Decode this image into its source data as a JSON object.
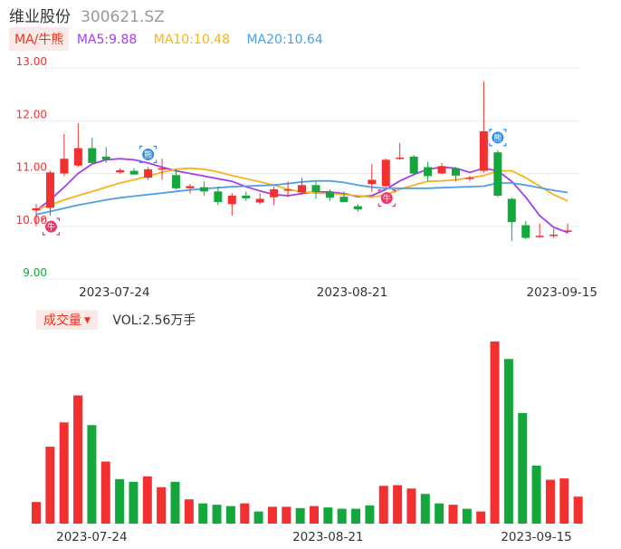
{
  "header": {
    "name": "维业股份",
    "code": "300621.SZ"
  },
  "ma_legend": {
    "toggle": "MA/牛熊",
    "items": [
      {
        "label": "MA5:9.88",
        "color": "#a23ef0"
      },
      {
        "label": "MA10:10.48",
        "color": "#f5b41e"
      },
      {
        "label": "MA20:10.64",
        "color": "#4c9fe8"
      }
    ]
  },
  "volume_legend": {
    "toggle": "成交量",
    "value": "VOL:2.56万手"
  },
  "colors": {
    "up": "#f23030",
    "down": "#14a83c",
    "grid": "#ececec"
  },
  "chart_data": [
    {
      "type": "candlestick",
      "ylim": [
        9.0,
        13.0
      ],
      "y_ticks": [
        "13.00",
        "12.00",
        "11.00",
        "10.00",
        "9.00"
      ],
      "x_tick_labels": [
        {
          "index": 3,
          "label": "2023-07-24"
        },
        {
          "index": 20,
          "label": "2023-08-21"
        },
        {
          "index": 35,
          "label": "2023-09-15"
        }
      ],
      "series": [
        {
          "name": "K",
          "values": [
            {
              "o": 10.3,
              "h": 10.42,
              "l": 10.0,
              "c": 10.34
            },
            {
              "o": 10.35,
              "h": 11.05,
              "l": 10.2,
              "c": 11.02
            },
            {
              "o": 11.0,
              "h": 11.75,
              "l": 10.95,
              "c": 11.28
            },
            {
              "o": 11.15,
              "h": 11.95,
              "l": 11.12,
              "c": 11.48
            },
            {
              "o": 11.48,
              "h": 11.68,
              "l": 11.18,
              "c": 11.2
            },
            {
              "o": 11.32,
              "h": 11.5,
              "l": 11.2,
              "c": 11.26
            },
            {
              "o": 11.02,
              "h": 11.1,
              "l": 11.0,
              "c": 11.06
            },
            {
              "o": 11.05,
              "h": 11.1,
              "l": 10.98,
              "c": 10.98
            },
            {
              "o": 10.92,
              "h": 11.12,
              "l": 10.88,
              "c": 11.08
            },
            {
              "o": 11.08,
              "h": 11.28,
              "l": 10.88,
              "c": 11.1
            },
            {
              "o": 10.97,
              "h": 11.08,
              "l": 10.7,
              "c": 10.72
            },
            {
              "o": 10.72,
              "h": 10.8,
              "l": 10.62,
              "c": 10.76
            },
            {
              "o": 10.74,
              "h": 10.85,
              "l": 10.58,
              "c": 10.66
            },
            {
              "o": 10.66,
              "h": 10.75,
              "l": 10.4,
              "c": 10.46
            },
            {
              "o": 10.42,
              "h": 10.63,
              "l": 10.2,
              "c": 10.58
            },
            {
              "o": 10.58,
              "h": 10.66,
              "l": 10.48,
              "c": 10.53
            },
            {
              "o": 10.45,
              "h": 10.62,
              "l": 10.42,
              "c": 10.52
            },
            {
              "o": 10.55,
              "h": 10.75,
              "l": 10.4,
              "c": 10.7
            },
            {
              "o": 10.7,
              "h": 10.85,
              "l": 10.55,
              "c": 10.7
            },
            {
              "o": 10.64,
              "h": 10.92,
              "l": 10.6,
              "c": 10.78
            },
            {
              "o": 10.78,
              "h": 10.85,
              "l": 10.52,
              "c": 10.66
            },
            {
              "o": 10.64,
              "h": 10.7,
              "l": 10.48,
              "c": 10.54
            },
            {
              "o": 10.56,
              "h": 10.66,
              "l": 10.45,
              "c": 10.46
            },
            {
              "o": 10.38,
              "h": 10.42,
              "l": 10.28,
              "c": 10.32
            },
            {
              "o": 10.8,
              "h": 11.18,
              "l": 10.65,
              "c": 10.88
            },
            {
              "o": 10.76,
              "h": 11.28,
              "l": 10.74,
              "c": 11.26
            },
            {
              "o": 11.28,
              "h": 11.58,
              "l": 11.26,
              "c": 11.3
            },
            {
              "o": 11.32,
              "h": 11.35,
              "l": 10.98,
              "c": 11.0
            },
            {
              "o": 11.12,
              "h": 11.22,
              "l": 10.85,
              "c": 10.95
            },
            {
              "o": 11.0,
              "h": 11.2,
              "l": 10.98,
              "c": 11.14
            },
            {
              "o": 11.1,
              "h": 11.12,
              "l": 10.85,
              "c": 10.96
            },
            {
              "o": 10.9,
              "h": 10.95,
              "l": 10.86,
              "c": 10.92
            },
            {
              "o": 11.05,
              "h": 12.75,
              "l": 11.02,
              "c": 11.8
            },
            {
              "o": 11.4,
              "h": 11.44,
              "l": 10.55,
              "c": 10.58
            },
            {
              "o": 10.52,
              "h": 10.54,
              "l": 9.72,
              "c": 10.08
            },
            {
              "o": 10.02,
              "h": 10.1,
              "l": 9.75,
              "c": 9.78
            },
            {
              "o": 9.8,
              "h": 10.05,
              "l": 9.78,
              "c": 9.82
            },
            {
              "o": 9.82,
              "h": 9.95,
              "l": 9.78,
              "c": 9.84
            },
            {
              "o": 9.9,
              "h": 10.05,
              "l": 9.86,
              "c": 9.92
            }
          ]
        },
        {
          "name": "MA5",
          "values": [
            10.3,
            10.5,
            10.74,
            11.0,
            11.18,
            11.26,
            11.28,
            11.26,
            11.2,
            11.12,
            11.05,
            11.0,
            10.95,
            10.9,
            10.85,
            10.75,
            10.67,
            10.6,
            10.58,
            10.62,
            10.65,
            10.65,
            10.62,
            10.56,
            10.58,
            10.7,
            10.86,
            10.98,
            11.08,
            11.12,
            11.1,
            11.02,
            11.1,
            11.05,
            10.85,
            10.55,
            10.2,
            9.98,
            9.88
          ]
        },
        {
          "name": "MA10",
          "values": [
            10.32,
            10.4,
            10.5,
            10.58,
            10.66,
            10.74,
            10.82,
            10.88,
            10.95,
            11.02,
            11.08,
            11.1,
            11.08,
            11.03,
            10.96,
            10.9,
            10.84,
            10.78,
            10.7,
            10.65,
            10.63,
            10.62,
            10.6,
            10.58,
            10.55,
            10.6,
            10.7,
            10.78,
            10.85,
            10.86,
            10.88,
            10.92,
            10.96,
            11.05,
            11.05,
            10.92,
            10.76,
            10.6,
            10.48
          ]
        },
        {
          "name": "MA20",
          "values": [
            10.22,
            10.28,
            10.34,
            10.4,
            10.45,
            10.5,
            10.54,
            10.57,
            10.6,
            10.63,
            10.66,
            10.69,
            10.71,
            10.73,
            10.75,
            10.76,
            10.77,
            10.78,
            10.81,
            10.84,
            10.86,
            10.86,
            10.83,
            10.78,
            10.74,
            10.72,
            10.72,
            10.72,
            10.72,
            10.73,
            10.74,
            10.75,
            10.76,
            10.82,
            10.82,
            10.78,
            10.73,
            10.68,
            10.64
          ]
        }
      ],
      "annotations": [
        {
          "index": 1,
          "label": "牛",
          "kind": "bull"
        },
        {
          "index": 8,
          "label": "熊",
          "kind": "bear"
        },
        {
          "index": 25,
          "label": "牛",
          "kind": "bull"
        },
        {
          "index": 33,
          "label": "熊",
          "kind": "bear"
        }
      ]
    },
    {
      "type": "bar",
      "title": "成交量",
      "x_tick_labels": [
        {
          "index": 1,
          "label": "2023-07-24"
        },
        {
          "index": 18,
          "label": "2023-08-21"
        },
        {
          "index": 33,
          "label": "2023-09-15"
        }
      ],
      "values": [
        {
          "v": 1.6,
          "dir": "up"
        },
        {
          "v": 5.7,
          "dir": "up"
        },
        {
          "v": 7.5,
          "dir": "up"
        },
        {
          "v": 9.5,
          "dir": "up"
        },
        {
          "v": 7.3,
          "dir": "down"
        },
        {
          "v": 4.6,
          "dir": "up"
        },
        {
          "v": 3.3,
          "dir": "down"
        },
        {
          "v": 3.1,
          "dir": "down"
        },
        {
          "v": 3.5,
          "dir": "up"
        },
        {
          "v": 2.7,
          "dir": "up"
        },
        {
          "v": 3.1,
          "dir": "down"
        },
        {
          "v": 1.8,
          "dir": "up"
        },
        {
          "v": 1.5,
          "dir": "down"
        },
        {
          "v": 1.4,
          "dir": "down"
        },
        {
          "v": 1.3,
          "dir": "down"
        },
        {
          "v": 1.5,
          "dir": "up"
        },
        {
          "v": 0.9,
          "dir": "down"
        },
        {
          "v": 1.25,
          "dir": "up"
        },
        {
          "v": 1.25,
          "dir": "up"
        },
        {
          "v": 1.15,
          "dir": "down"
        },
        {
          "v": 1.3,
          "dir": "up"
        },
        {
          "v": 1.2,
          "dir": "down"
        },
        {
          "v": 1.1,
          "dir": "down"
        },
        {
          "v": 1.1,
          "dir": "down"
        },
        {
          "v": 1.35,
          "dir": "down"
        },
        {
          "v": 2.8,
          "dir": "up"
        },
        {
          "v": 2.85,
          "dir": "up"
        },
        {
          "v": 2.6,
          "dir": "up"
        },
        {
          "v": 2.2,
          "dir": "down"
        },
        {
          "v": 1.5,
          "dir": "down"
        },
        {
          "v": 1.4,
          "dir": "up"
        },
        {
          "v": 1.1,
          "dir": "down"
        },
        {
          "v": 0.9,
          "dir": "up"
        },
        {
          "v": 13.5,
          "dir": "up"
        },
        {
          "v": 12.2,
          "dir": "down"
        },
        {
          "v": 8.2,
          "dir": "down"
        },
        {
          "v": 4.3,
          "dir": "down"
        },
        {
          "v": 3.25,
          "dir": "up"
        },
        {
          "v": 3.35,
          "dir": "up"
        },
        {
          "v": 2.0,
          "dir": "up"
        }
      ]
    }
  ]
}
